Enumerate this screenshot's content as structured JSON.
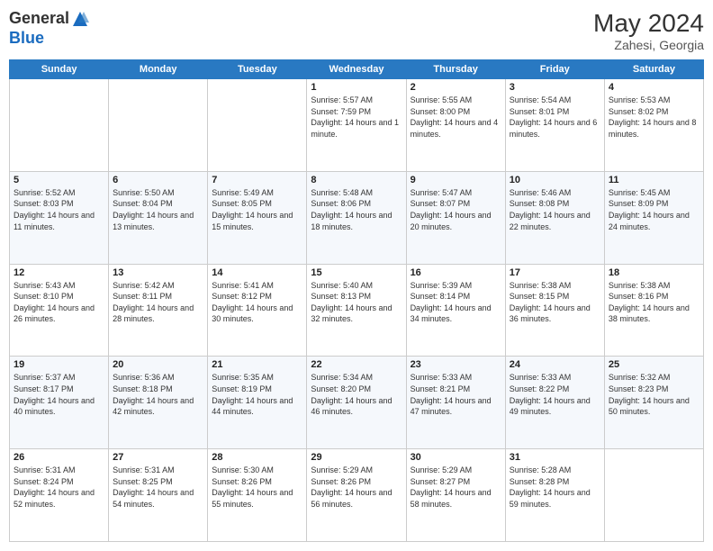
{
  "header": {
    "logo_general": "General",
    "logo_blue": "Blue",
    "month_year": "May 2024",
    "location": "Zahesi, Georgia"
  },
  "days_of_week": [
    "Sunday",
    "Monday",
    "Tuesday",
    "Wednesday",
    "Thursday",
    "Friday",
    "Saturday"
  ],
  "weeks": [
    [
      {
        "day": "",
        "sunrise": "",
        "sunset": "",
        "daylight": ""
      },
      {
        "day": "",
        "sunrise": "",
        "sunset": "",
        "daylight": ""
      },
      {
        "day": "",
        "sunrise": "",
        "sunset": "",
        "daylight": ""
      },
      {
        "day": "1",
        "sunrise": "Sunrise: 5:57 AM",
        "sunset": "Sunset: 7:59 PM",
        "daylight": "Daylight: 14 hours and 1 minute."
      },
      {
        "day": "2",
        "sunrise": "Sunrise: 5:55 AM",
        "sunset": "Sunset: 8:00 PM",
        "daylight": "Daylight: 14 hours and 4 minutes."
      },
      {
        "day": "3",
        "sunrise": "Sunrise: 5:54 AM",
        "sunset": "Sunset: 8:01 PM",
        "daylight": "Daylight: 14 hours and 6 minutes."
      },
      {
        "day": "4",
        "sunrise": "Sunrise: 5:53 AM",
        "sunset": "Sunset: 8:02 PM",
        "daylight": "Daylight: 14 hours and 8 minutes."
      }
    ],
    [
      {
        "day": "5",
        "sunrise": "Sunrise: 5:52 AM",
        "sunset": "Sunset: 8:03 PM",
        "daylight": "Daylight: 14 hours and 11 minutes."
      },
      {
        "day": "6",
        "sunrise": "Sunrise: 5:50 AM",
        "sunset": "Sunset: 8:04 PM",
        "daylight": "Daylight: 14 hours and 13 minutes."
      },
      {
        "day": "7",
        "sunrise": "Sunrise: 5:49 AM",
        "sunset": "Sunset: 8:05 PM",
        "daylight": "Daylight: 14 hours and 15 minutes."
      },
      {
        "day": "8",
        "sunrise": "Sunrise: 5:48 AM",
        "sunset": "Sunset: 8:06 PM",
        "daylight": "Daylight: 14 hours and 18 minutes."
      },
      {
        "day": "9",
        "sunrise": "Sunrise: 5:47 AM",
        "sunset": "Sunset: 8:07 PM",
        "daylight": "Daylight: 14 hours and 20 minutes."
      },
      {
        "day": "10",
        "sunrise": "Sunrise: 5:46 AM",
        "sunset": "Sunset: 8:08 PM",
        "daylight": "Daylight: 14 hours and 22 minutes."
      },
      {
        "day": "11",
        "sunrise": "Sunrise: 5:45 AM",
        "sunset": "Sunset: 8:09 PM",
        "daylight": "Daylight: 14 hours and 24 minutes."
      }
    ],
    [
      {
        "day": "12",
        "sunrise": "Sunrise: 5:43 AM",
        "sunset": "Sunset: 8:10 PM",
        "daylight": "Daylight: 14 hours and 26 minutes."
      },
      {
        "day": "13",
        "sunrise": "Sunrise: 5:42 AM",
        "sunset": "Sunset: 8:11 PM",
        "daylight": "Daylight: 14 hours and 28 minutes."
      },
      {
        "day": "14",
        "sunrise": "Sunrise: 5:41 AM",
        "sunset": "Sunset: 8:12 PM",
        "daylight": "Daylight: 14 hours and 30 minutes."
      },
      {
        "day": "15",
        "sunrise": "Sunrise: 5:40 AM",
        "sunset": "Sunset: 8:13 PM",
        "daylight": "Daylight: 14 hours and 32 minutes."
      },
      {
        "day": "16",
        "sunrise": "Sunrise: 5:39 AM",
        "sunset": "Sunset: 8:14 PM",
        "daylight": "Daylight: 14 hours and 34 minutes."
      },
      {
        "day": "17",
        "sunrise": "Sunrise: 5:38 AM",
        "sunset": "Sunset: 8:15 PM",
        "daylight": "Daylight: 14 hours and 36 minutes."
      },
      {
        "day": "18",
        "sunrise": "Sunrise: 5:38 AM",
        "sunset": "Sunset: 8:16 PM",
        "daylight": "Daylight: 14 hours and 38 minutes."
      }
    ],
    [
      {
        "day": "19",
        "sunrise": "Sunrise: 5:37 AM",
        "sunset": "Sunset: 8:17 PM",
        "daylight": "Daylight: 14 hours and 40 minutes."
      },
      {
        "day": "20",
        "sunrise": "Sunrise: 5:36 AM",
        "sunset": "Sunset: 8:18 PM",
        "daylight": "Daylight: 14 hours and 42 minutes."
      },
      {
        "day": "21",
        "sunrise": "Sunrise: 5:35 AM",
        "sunset": "Sunset: 8:19 PM",
        "daylight": "Daylight: 14 hours and 44 minutes."
      },
      {
        "day": "22",
        "sunrise": "Sunrise: 5:34 AM",
        "sunset": "Sunset: 8:20 PM",
        "daylight": "Daylight: 14 hours and 46 minutes."
      },
      {
        "day": "23",
        "sunrise": "Sunrise: 5:33 AM",
        "sunset": "Sunset: 8:21 PM",
        "daylight": "Daylight: 14 hours and 47 minutes."
      },
      {
        "day": "24",
        "sunrise": "Sunrise: 5:33 AM",
        "sunset": "Sunset: 8:22 PM",
        "daylight": "Daylight: 14 hours and 49 minutes."
      },
      {
        "day": "25",
        "sunrise": "Sunrise: 5:32 AM",
        "sunset": "Sunset: 8:23 PM",
        "daylight": "Daylight: 14 hours and 50 minutes."
      }
    ],
    [
      {
        "day": "26",
        "sunrise": "Sunrise: 5:31 AM",
        "sunset": "Sunset: 8:24 PM",
        "daylight": "Daylight: 14 hours and 52 minutes."
      },
      {
        "day": "27",
        "sunrise": "Sunrise: 5:31 AM",
        "sunset": "Sunset: 8:25 PM",
        "daylight": "Daylight: 14 hours and 54 minutes."
      },
      {
        "day": "28",
        "sunrise": "Sunrise: 5:30 AM",
        "sunset": "Sunset: 8:26 PM",
        "daylight": "Daylight: 14 hours and 55 minutes."
      },
      {
        "day": "29",
        "sunrise": "Sunrise: 5:29 AM",
        "sunset": "Sunset: 8:26 PM",
        "daylight": "Daylight: 14 hours and 56 minutes."
      },
      {
        "day": "30",
        "sunrise": "Sunrise: 5:29 AM",
        "sunset": "Sunset: 8:27 PM",
        "daylight": "Daylight: 14 hours and 58 minutes."
      },
      {
        "day": "31",
        "sunrise": "Sunrise: 5:28 AM",
        "sunset": "Sunset: 8:28 PM",
        "daylight": "Daylight: 14 hours and 59 minutes."
      },
      {
        "day": "",
        "sunrise": "",
        "sunset": "",
        "daylight": ""
      }
    ]
  ]
}
